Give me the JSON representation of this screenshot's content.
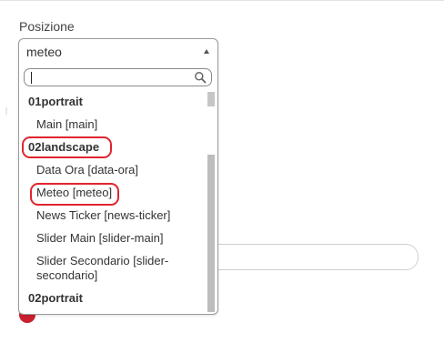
{
  "form": {
    "field_label": "Posizione",
    "selected_value": "meteo",
    "search_value": ""
  },
  "dropdown": {
    "groups": [
      {
        "label": "01portrait",
        "options": [
          "Main [main]"
        ]
      },
      {
        "label": "02landscape",
        "options": [
          "Data Ora [data-ora]",
          "Meteo [meteo]",
          "News Ticker [news-ticker]",
          "Slider Main [slider-main]",
          "Slider Secondario [slider-secondario]"
        ]
      },
      {
        "label": "02portrait",
        "options": []
      }
    ]
  },
  "annotations": {
    "highlighted": [
      "02landscape",
      "Meteo [meteo]"
    ],
    "color": "#e0252e"
  },
  "icons": {
    "search": "search-icon",
    "arrow": "chevron-up-icon"
  },
  "colors": {
    "accent": "#c9202f",
    "highlight": "#e0252e"
  }
}
